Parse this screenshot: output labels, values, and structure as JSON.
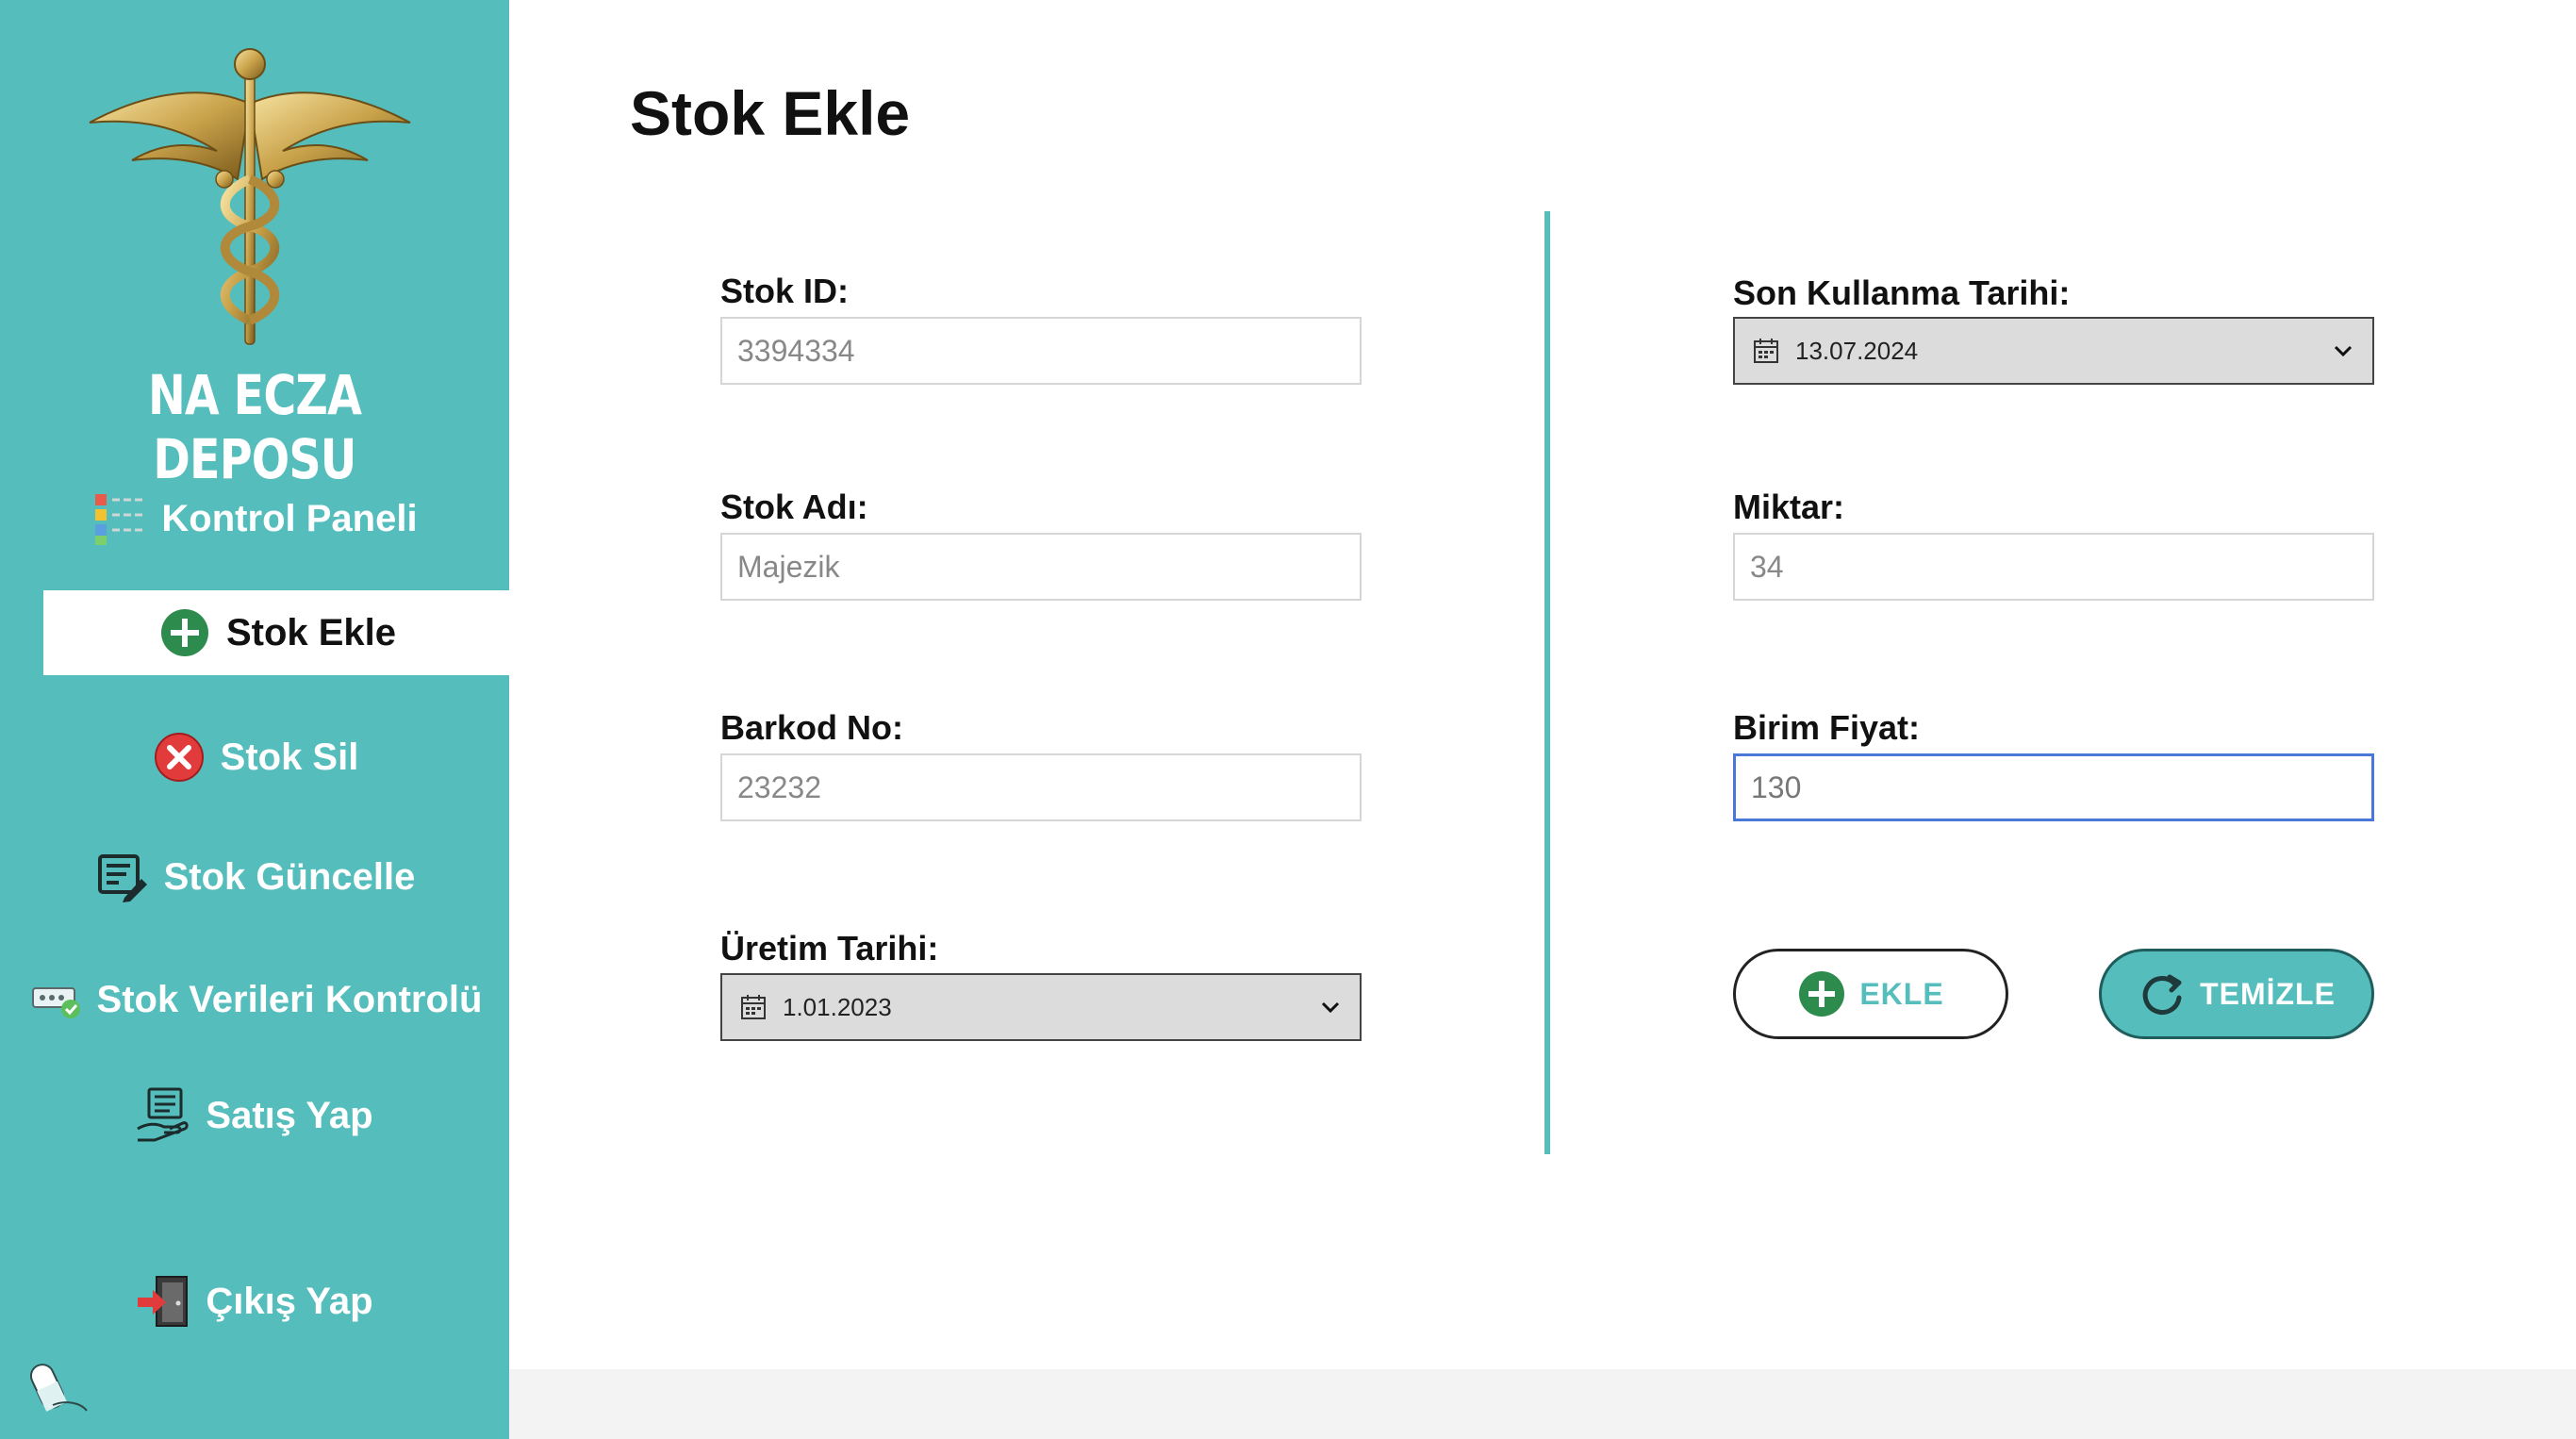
{
  "sidebar": {
    "brand": "NA ECZA DEPOSU",
    "items": [
      {
        "label": "Kontrol Paneli",
        "icon": "dashboard-icon"
      },
      {
        "label": "Stok Ekle",
        "icon": "plus-circle-icon",
        "active": true
      },
      {
        "label": "Stok Sil",
        "icon": "x-circle-icon"
      },
      {
        "label": "Stok Güncelle",
        "icon": "edit-list-icon"
      },
      {
        "label": "Stok Verileri Kontrolü",
        "icon": "data-check-icon"
      },
      {
        "label": "Satış Yap",
        "icon": "cash-register-icon"
      },
      {
        "label": "Çıkış Yap",
        "icon": "exit-door-icon"
      }
    ]
  },
  "main": {
    "title": "Stok Ekle",
    "fields": {
      "stok_id": {
        "label": "Stok ID:",
        "value": "3394334"
      },
      "stok_adi": {
        "label": "Stok Adı:",
        "value": "Majezik"
      },
      "barkod_no": {
        "label": "Barkod No:",
        "value": "23232"
      },
      "uretim_tarihi": {
        "label": "Üretim Tarihi:",
        "value": "1.01.2023"
      },
      "son_kullanma_tarihi": {
        "label": "Son Kullanma Tarihi:",
        "value": "13.07.2024"
      },
      "miktar": {
        "label": "Miktar:",
        "value": "34"
      },
      "birim_fiyat": {
        "label": "Birim Fiyat:",
        "value": "130"
      }
    },
    "buttons": {
      "add": "EKLE",
      "clear": "TEMİZLE"
    }
  },
  "colors": {
    "accent": "#56bdbd",
    "active_bg": "#ffffff",
    "add_icon": "#2e8b4e",
    "delete_icon": "#e23b3b",
    "focus_border": "#4a78d8"
  }
}
